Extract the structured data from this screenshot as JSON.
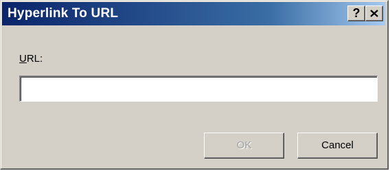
{
  "dialog": {
    "title": "Hyperlink To URL",
    "help_button_label": "?",
    "close_icon": "close-icon"
  },
  "form": {
    "url_label_accel": "U",
    "url_label_rest": "RL:",
    "url_value": "",
    "url_placeholder": ""
  },
  "buttons": {
    "ok_label": "OK",
    "ok_enabled": false,
    "cancel_label": "Cancel"
  },
  "colors": {
    "titlebar_start": "#0a246a",
    "titlebar_end": "#a6caf0",
    "dialog_face": "#d4d0c8",
    "disabled_text": "#a0a0a0"
  }
}
